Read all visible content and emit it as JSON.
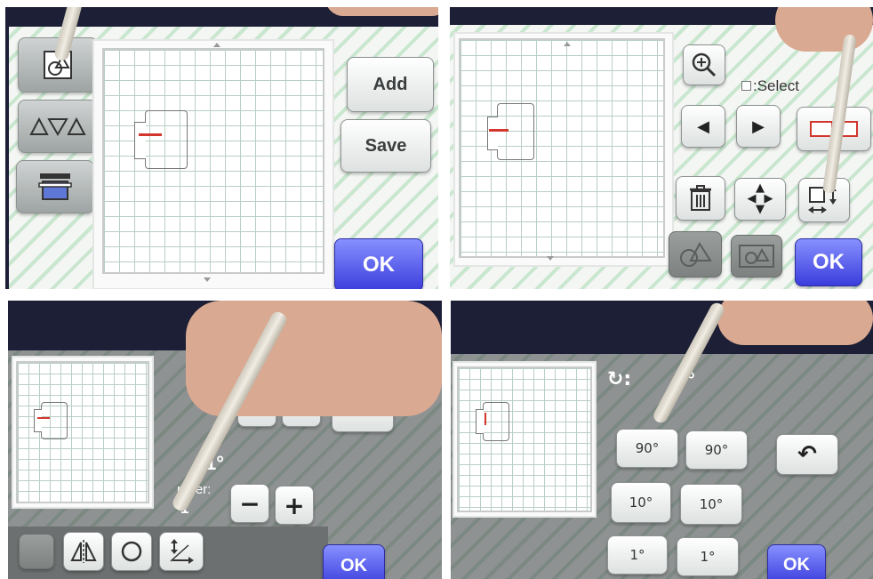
{
  "panel1": {
    "add_label": "Add",
    "save_label": "Save",
    "ok_label": "OK",
    "icons": [
      "pattern-select-icon",
      "shapes-icon",
      "mat-tray-icon"
    ]
  },
  "panel2": {
    "select_label": ":Select",
    "ok_label": "OK",
    "icons": [
      "zoom-icon",
      "left-arrow-icon",
      "right-arrow-icon",
      "selection-frame-icon",
      "trash-icon",
      "move-icon",
      "resize-icon",
      "shape-select-icon",
      "group-icon"
    ]
  },
  "panel3": {
    "partial_label_1": "1°",
    "partial_label_2": "mber:",
    "number_value": "1",
    "ok_label": "OK",
    "icons": [
      "close-icon",
      "undo-icon",
      "mirror-icon",
      "rotate-icon",
      "resize-icon",
      "minus-icon",
      "plus-icon"
    ]
  },
  "panel4": {
    "rotation_value": "°",
    "rot_left_90": "90°",
    "rot_right_90": "90°",
    "rot_left_10": "10°",
    "rot_right_10": "10°",
    "rot_left_1": "1°",
    "rot_right_1": "1°",
    "ok_label": "OK",
    "icons": [
      "rotate-icon",
      "undo-icon"
    ]
  },
  "colors": {
    "ok_button": "#3b3ddc",
    "cut_line": "#d2362c",
    "grid_line": "#b8cfc3"
  }
}
